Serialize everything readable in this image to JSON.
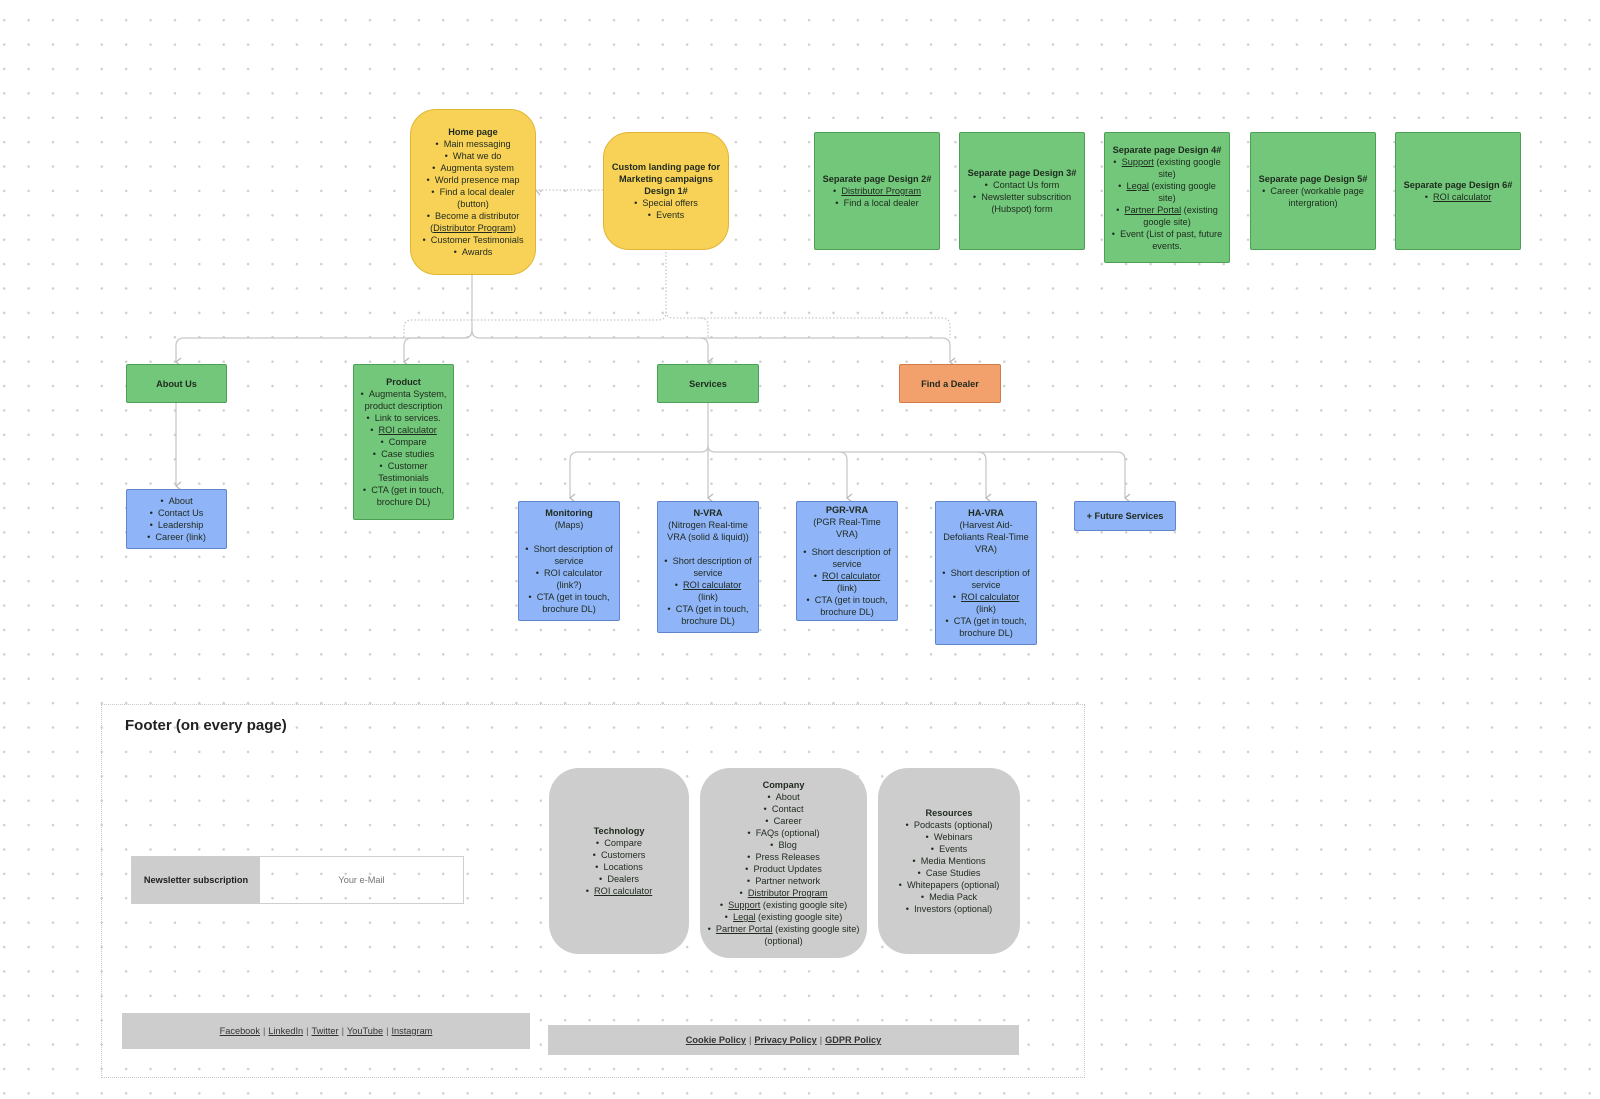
{
  "home": {
    "title": "Home page",
    "items": [
      "Main messaging",
      "What we do",
      "Augmenta system",
      "World presence map",
      "Find a local dealer (button)",
      "Become a distributor ("
    ],
    "distributor_link": "Distributor Program",
    "items_after": [
      "Customer Testimonials",
      "Awards"
    ]
  },
  "landing": {
    "title": "Custom landing page for Marketing campaigns Design 1#",
    "items": [
      "Special offers",
      "Events"
    ]
  },
  "separate_pages": [
    {
      "title": "Separate page Design 2#",
      "items": [
        {
          "text": "Distributor Program",
          "link": true
        },
        {
          "text": "Find a local dealer",
          "link": false
        }
      ]
    },
    {
      "title": "Separate page Design 3#",
      "items": [
        {
          "text": "Contact Us form",
          "link": false
        },
        {
          "text": "Newsletter subscrition (Hubspot) form",
          "link": false
        }
      ]
    },
    {
      "title": "Separate page Design 4#",
      "items": [
        {
          "text": "Support",
          "link": true,
          "suffix": " (existing google site)"
        },
        {
          "text": "Legal",
          "link": true,
          "suffix": " (existing google site)"
        },
        {
          "text": "Partner Portal",
          "link": true,
          "suffix": "  (existing google site)"
        },
        {
          "text": "Event (List of past, future events.",
          "link": false
        }
      ]
    },
    {
      "title": "Separate page Design 5#",
      "items": [
        {
          "text": "Career (workable page intergration)",
          "link": false
        }
      ]
    },
    {
      "title": "Separate page Design 6#",
      "items": [
        {
          "text": "ROI calculator",
          "link": true
        }
      ]
    }
  ],
  "about": {
    "title": "About Us",
    "children": [
      "About",
      "Contact Us",
      "Leadership",
      "Career (link)"
    ]
  },
  "product": {
    "title": "Product",
    "items": [
      "Augmenta System, product description",
      "Link to services."
    ],
    "roi_link": "ROI calculator",
    "items_after": [
      "Compare",
      "Case studies",
      "Customer Testimonials",
      "CTA (get in touch, brochure DL)"
    ]
  },
  "services": {
    "title": "Services",
    "children": [
      {
        "title": "Monitoring",
        "subtitle": "(Maps)",
        "desc": "Short description of service",
        "roi": "ROI calculator (link?)",
        "roi_link": false,
        "cta": "CTA (get in touch, brochure DL)"
      },
      {
        "title": "N-VRA",
        "subtitle": "(Nitrogen Real-time VRA (solid & liquid))",
        "desc": "Short description of service",
        "roi": "ROI calculator",
        "roi_suffix": "(link)",
        "roi_link": true,
        "cta": "CTA (get in touch, brochure DL)"
      },
      {
        "title": "PGR-VRA",
        "subtitle": "(PGR Real-Time VRA)",
        "desc": "Short description of service",
        "roi": "ROI calculator",
        "roi_suffix": "(link)",
        "roi_link": true,
        "cta": "CTA (get in touch, brochure DL)"
      },
      {
        "title": "HA-VRA",
        "subtitle": "(Harvest Aid-Defoliants Real-Time VRA)",
        "desc": "Short description of service",
        "roi": "ROI calculator",
        "roi_suffix": "(link)",
        "roi_link": true,
        "cta": "CTA (get in touch, brochure DL)"
      }
    ],
    "future": "+ Future Services"
  },
  "dealer": {
    "title": "Find a Dealer"
  },
  "footer": {
    "title": "Footer (on every page)",
    "newsletter_label": "Newsletter subscription",
    "email_placeholder": "Your e-Mail",
    "technology": {
      "title": "Technology",
      "items": [
        "Compare",
        "Customers",
        "Locations",
        "Dealers"
      ],
      "roi_link": "ROI calculator"
    },
    "company": {
      "title": "Company",
      "items": [
        "About",
        "Contact",
        "Career",
        "FAQs  (optional)",
        "Blog",
        "Press Releases",
        "Product Updates",
        "Partner network"
      ],
      "links": [
        {
          "text": "Distributor Program",
          "suffix": ""
        },
        {
          "text": "Support",
          "suffix": " (existing google site)"
        },
        {
          "text": "Legal",
          "suffix": " (existing google site)"
        },
        {
          "text": "Partner Portal",
          "suffix": " (existing google site)  (optional)"
        }
      ]
    },
    "resources": {
      "title": "Resources",
      "items": [
        "Podcasts  (optional)",
        "Webinars",
        "Events",
        "Media Mentions",
        "Case Studies",
        "Whitepapers  (optional)",
        "Media Pack",
        "Investors (optional)"
      ]
    },
    "social": [
      "Facebook",
      "LinkedIn",
      "Twitter",
      "YouTube",
      "Instagram"
    ],
    "policies": [
      "Cookie Policy",
      "Privacy Policy",
      "GDPR Policy"
    ]
  }
}
